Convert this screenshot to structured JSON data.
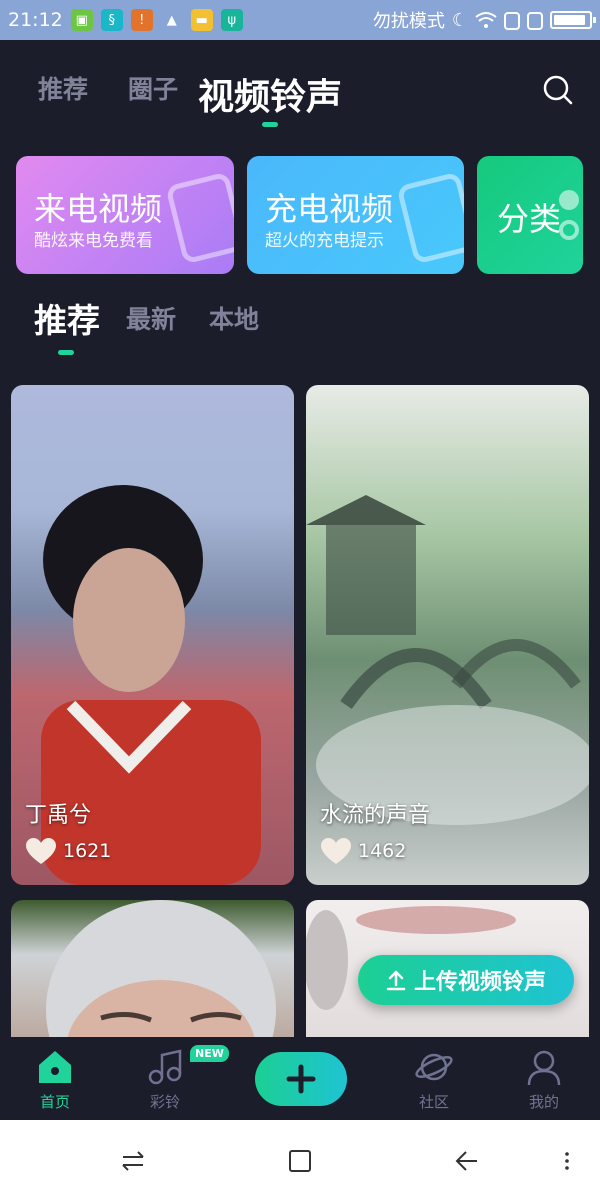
{
  "status_bar": {
    "time": "21:12",
    "dnd_text": "勿扰模式",
    "battery_level": 0.9
  },
  "top_nav": {
    "tabs": [
      "推荐",
      "圈子",
      "视频铃声"
    ],
    "active_index": 2,
    "search_icon": "search-icon"
  },
  "feature_cards": [
    {
      "title": "来电视频",
      "subtitle": "酷炫来电免费看",
      "icon": "phone-icon",
      "color_from": "#e28af0",
      "color_to": "#a97cf6"
    },
    {
      "title": "充电视频",
      "subtitle": "超火的充电提示",
      "icon": "battery-icon",
      "color_from": "#4ab8fb",
      "color_to": "#49c8fb"
    },
    {
      "title": "分类",
      "subtitle": "",
      "icon": "category-icon",
      "color_from": "#16c97d",
      "color_to": "#1fd39b"
    }
  ],
  "sub_tabs": [
    "推荐",
    "最新",
    "本地"
  ],
  "videos": [
    {
      "title": "丁禹兮",
      "likes": "1621"
    },
    {
      "title": "水流的声音",
      "likes": "1462"
    },
    {
      "title": "",
      "likes": ""
    },
    {
      "title": "",
      "likes": ""
    }
  ],
  "upload_button": "上传视频铃声",
  "bottom_nav": {
    "items": [
      {
        "label": "首页",
        "icon": "home-icon"
      },
      {
        "label": "彩铃",
        "icon": "music-note-icon"
      },
      {
        "label": "",
        "icon": "plus-icon"
      },
      {
        "label": "社区",
        "icon": "planet-icon"
      },
      {
        "label": "我的",
        "icon": "profile-icon"
      }
    ],
    "active_index": 0,
    "new_badge": "NEW"
  },
  "colors": {
    "background": "#1c1d2b",
    "accent": "#1fd39b",
    "status_bar": "#89a5d6"
  }
}
